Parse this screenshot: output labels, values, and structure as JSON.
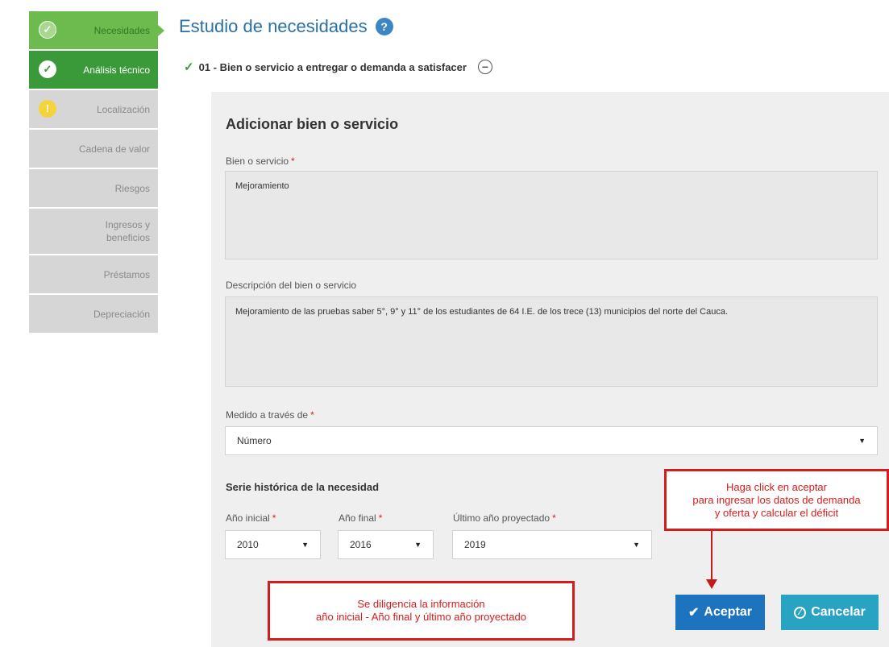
{
  "sidebar": {
    "items": [
      {
        "label": "Necesidades",
        "state": "active",
        "icon": "check-icon"
      },
      {
        "label": "Análisis técnico",
        "state": "done",
        "icon": "check-icon"
      },
      {
        "label": "Localización",
        "state": "warning",
        "icon": "warning-icon"
      },
      {
        "label": "Cadena de valor",
        "state": "disabled"
      },
      {
        "label": "Riesgos",
        "state": "disabled"
      },
      {
        "label": "Ingresos y beneficios",
        "state": "disabled"
      },
      {
        "label": "Préstamos",
        "state": "disabled"
      },
      {
        "label": "Depreciación",
        "state": "disabled"
      }
    ]
  },
  "header": {
    "title": "Estudio de necesidades",
    "help_icon": "?"
  },
  "section": {
    "check": "✓",
    "number": "01",
    "title": " - Bien o servicio a entregar o demanda a satisfacer",
    "collapse_icon": "−"
  },
  "form": {
    "title": "Adicionar bien o servicio",
    "required_mark": "*",
    "bien_label": "Bien o servicio",
    "bien_value": "Mejoramiento",
    "descripcion_label": "Descripción del bien o servicio",
    "descripcion_value": "Mejoramiento de las pruebas saber 5°, 9° y 11° de los estudiantes de 64 I.E. de los trece (13) municipios del norte del Cauca.",
    "medido_label": "Medido a través de",
    "medido_value": "Número",
    "serie_title": "Serie histórica de la necesidad",
    "anio_inicial_label": "Año inicial",
    "anio_inicial_value": "2010",
    "anio_final_label": "Año final",
    "anio_final_value": "2016",
    "ultimo_label": "Último año proyectado",
    "ultimo_value": "2019"
  },
  "buttons": {
    "accept_label": "Aceptar",
    "accept_icon": "✔",
    "cancel_label": "Cancelar"
  },
  "callouts": {
    "accept_note": [
      "Haga click en aceptar",
      "para ingresar los datos de demanda",
      "y oferta  y calcular el déficit"
    ],
    "years_note": [
      "Se diligencia la información",
      "año inicial - Año final y último año proyectado"
    ]
  },
  "colors": {
    "active_green": "#6dbb4e",
    "done_green": "#3a9a3a",
    "title_blue": "#2a6fa8",
    "accept_blue": "#1e73be",
    "cancel_teal": "#29a3c2",
    "callout_red": "#d41c1c"
  }
}
